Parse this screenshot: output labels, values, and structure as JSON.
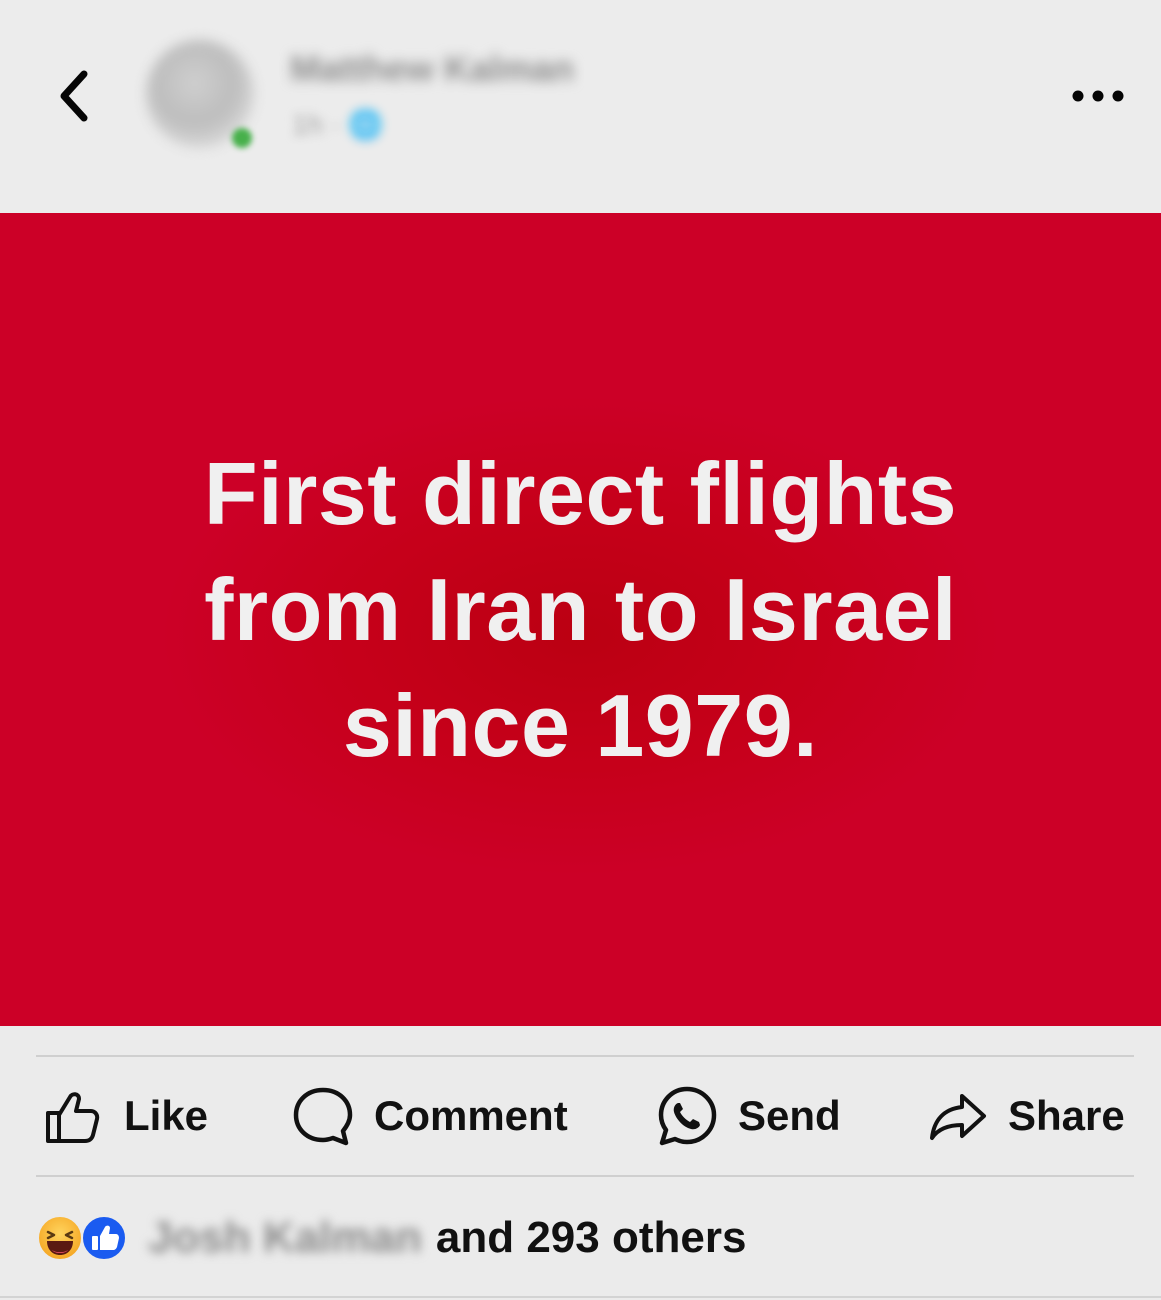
{
  "header": {
    "author_name": "Matthew Kalman",
    "post_meta": "1h · ",
    "back_icon": "chevron-left-icon",
    "more_icon": "more-horizontal-icon"
  },
  "post": {
    "image_lines": [
      "First direct flights",
      "from Iran to Israel",
      "since 1979."
    ],
    "background_color": "#cc0027",
    "text_color": "#f0f0f0"
  },
  "actions": {
    "like": "Like",
    "comment": "Comment",
    "send": "Send",
    "share": "Share"
  },
  "reactions": {
    "reactor_name": "Josh Kalman",
    "summary": "and 293 others",
    "types": [
      "haha",
      "like"
    ]
  }
}
